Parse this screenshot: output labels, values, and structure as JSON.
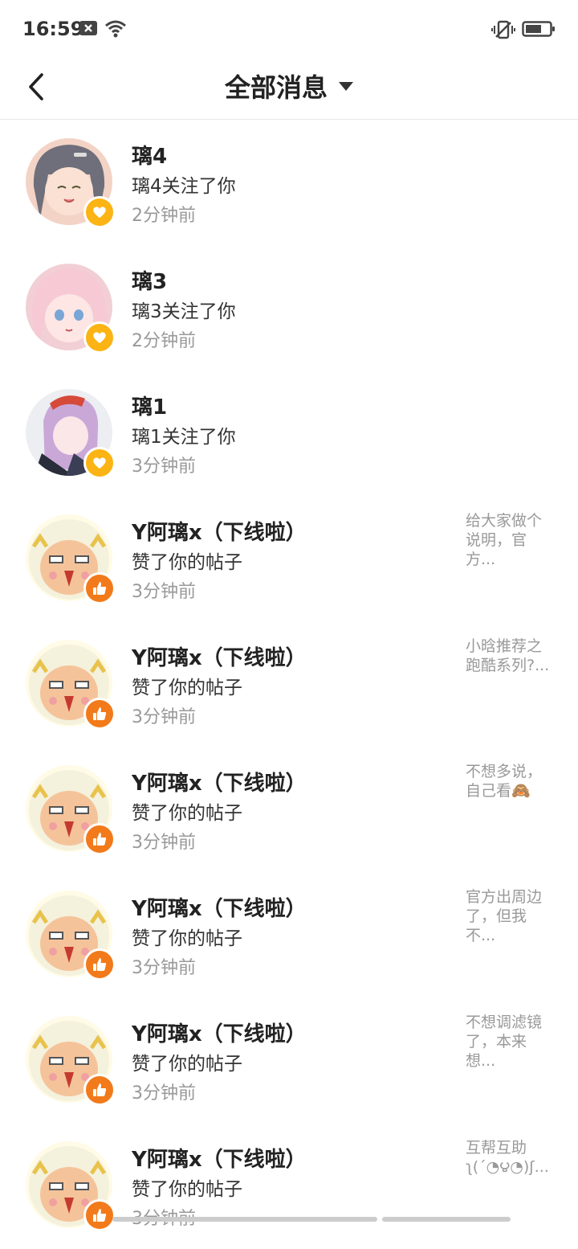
{
  "status_bar": {
    "time": "16:59"
  },
  "header": {
    "title": "全部消息"
  },
  "messages": [
    {
      "name": "璃4",
      "action": "璃4关注了你",
      "time": "2分钟前",
      "badge": "heart",
      "preview": ""
    },
    {
      "name": "璃3",
      "action": "璃3关注了你",
      "time": "2分钟前",
      "badge": "heart",
      "preview": ""
    },
    {
      "name": "璃1",
      "action": "璃1关注了你",
      "time": "3分钟前",
      "badge": "heart",
      "preview": ""
    },
    {
      "name": "Y阿璃x（下线啦）",
      "action": "赞了你的帖子",
      "time": "3分钟前",
      "badge": "like",
      "preview": "给大家做个说明，官方..."
    },
    {
      "name": "Y阿璃x（下线啦）",
      "action": "赞了你的帖子",
      "time": "3分钟前",
      "badge": "like",
      "preview": "小晗推荐之跑酷系列?..."
    },
    {
      "name": "Y阿璃x（下线啦）",
      "action": "赞了你的帖子",
      "time": "3分钟前",
      "badge": "like",
      "preview": "不想多说，自己看🙈"
    },
    {
      "name": "Y阿璃x（下线啦）",
      "action": "赞了你的帖子",
      "time": "3分钟前",
      "badge": "like",
      "preview": "官方出周边了，但我不..."
    },
    {
      "name": "Y阿璃x（下线啦）",
      "action": "赞了你的帖子",
      "time": "3分钟前",
      "badge": "like",
      "preview": "不想调滤镜了，本来想..."
    },
    {
      "name": "Y阿璃x（下线啦）",
      "action": "赞了你的帖子",
      "time": "3分钟前",
      "badge": "like",
      "preview": "互帮互助ʅ(´◔౪◔)ʃ..."
    }
  ]
}
